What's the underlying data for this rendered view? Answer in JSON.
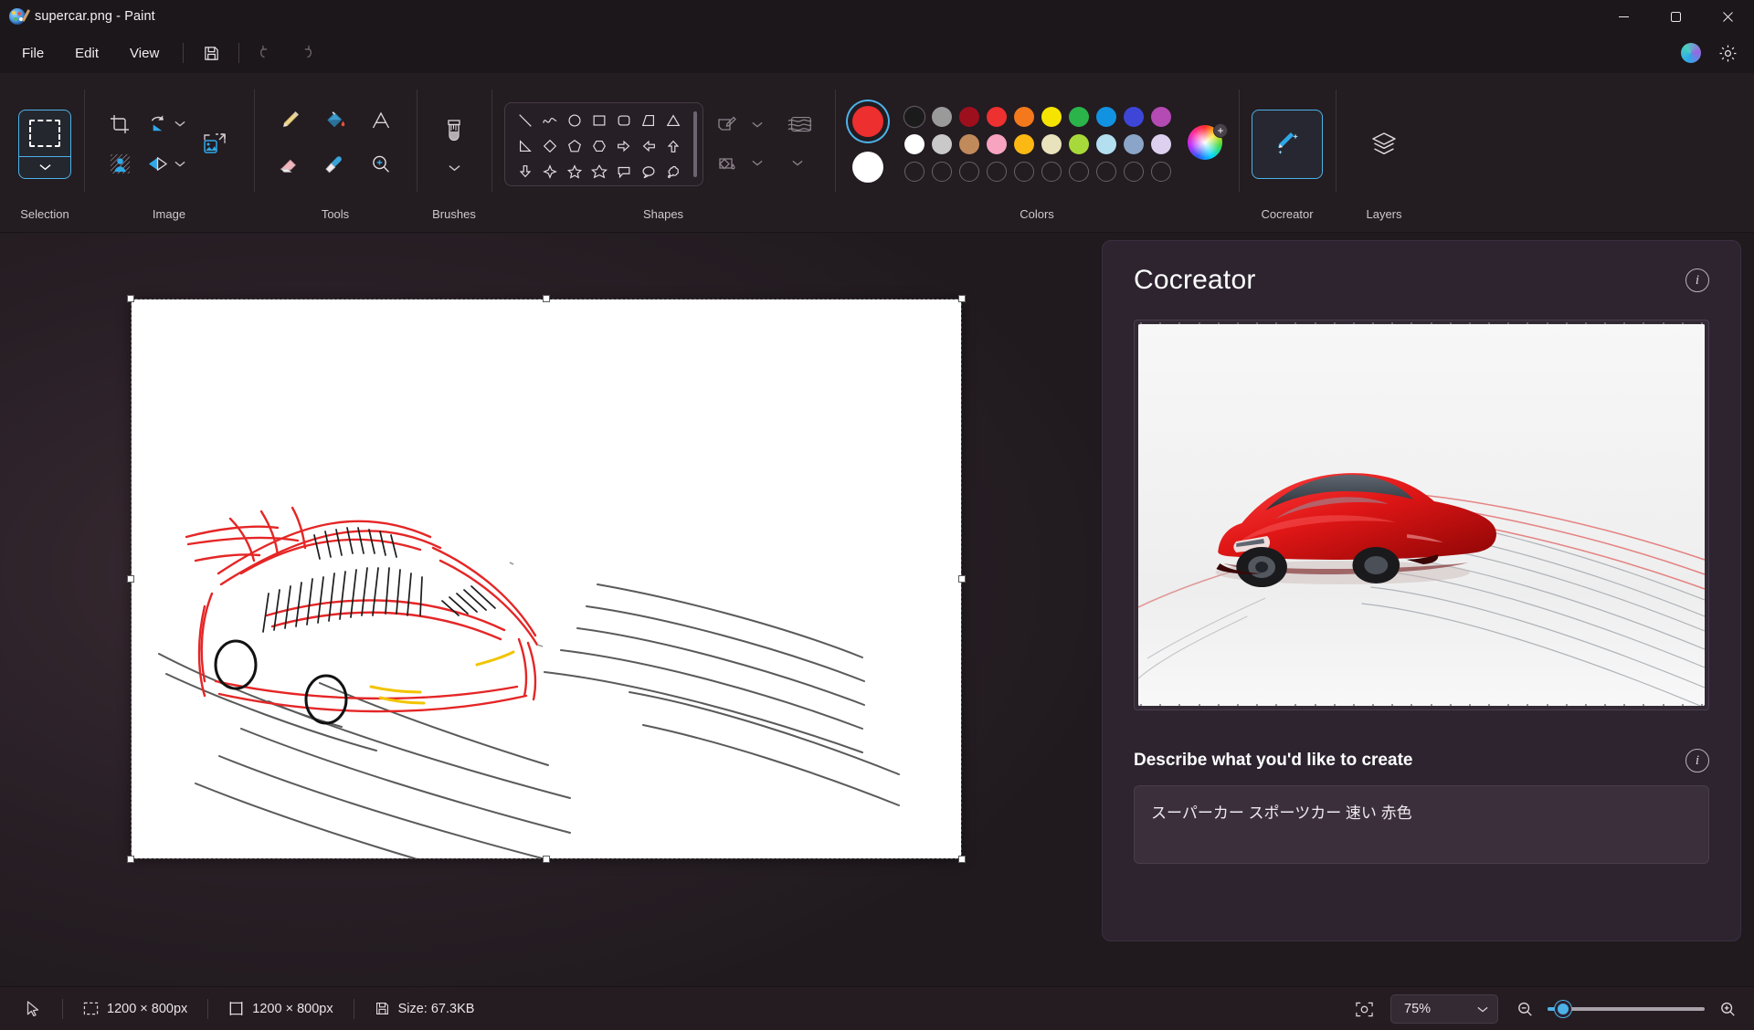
{
  "window": {
    "title": "supercar.png - Paint",
    "app_icon": "paint-palette-icon",
    "controls": {
      "minimize": "minimize-icon",
      "maximize": "maximize-icon",
      "close": "close-icon"
    }
  },
  "menubar": {
    "items": [
      {
        "label": "File",
        "name": "menu-file"
      },
      {
        "label": "Edit",
        "name": "menu-edit"
      },
      {
        "label": "View",
        "name": "menu-view"
      }
    ],
    "quick_access": [
      {
        "name": "save-icon",
        "enabled": true
      },
      {
        "name": "undo-icon",
        "enabled": false
      },
      {
        "name": "redo-icon",
        "enabled": false
      }
    ],
    "right_icons": [
      {
        "name": "copilot-icon"
      },
      {
        "name": "settings-gear-icon"
      }
    ]
  },
  "ribbon": {
    "groups": [
      {
        "label": "Selection",
        "name": "ribbon-group-selection"
      },
      {
        "label": "Image",
        "name": "ribbon-group-image"
      },
      {
        "label": "Tools",
        "name": "ribbon-group-tools"
      },
      {
        "label": "Brushes",
        "name": "ribbon-group-brushes"
      },
      {
        "label": "Shapes",
        "name": "ribbon-group-shapes"
      },
      {
        "label": "Colors",
        "name": "ribbon-group-colors"
      },
      {
        "label": "Cocreator",
        "name": "ribbon-group-cocreator"
      },
      {
        "label": "Layers",
        "name": "ribbon-group-layers"
      }
    ],
    "tools": [
      "pencil-icon",
      "fill-bucket-icon",
      "text-icon",
      "eraser-icon",
      "eyedropper-icon",
      "magnifier-icon"
    ],
    "image_tools": [
      "crop-icon",
      "rotate-icon",
      "remove-background-icon",
      "flip-icon",
      "resize-icon"
    ],
    "shapes": [
      "line",
      "curve",
      "oval",
      "rectangle",
      "rounded-rectangle",
      "right-trapezoid",
      "triangle",
      "right-triangle",
      "diamond",
      "pentagon",
      "hexagon",
      "right-arrow",
      "left-arrow",
      "up-arrow-block",
      "down-arrow",
      "four-point-star",
      "five-point-star",
      "six-point-star",
      "rounded-callout",
      "oval-callout",
      "cloud-callout"
    ],
    "shape_options": [
      "shape-outline-icon",
      "shape-fill-icon",
      "shape-style-icon"
    ]
  },
  "colors": {
    "primary": "#ed2f2f",
    "secondary": "#ffffff",
    "primary_selected": true,
    "palette_row1": [
      "#1b1b1b",
      "#9a9a9a",
      "#9e0f1e",
      "#ed3030",
      "#f3791c",
      "#f5e400",
      "#2bb44a",
      "#1193e2",
      "#3d46d6",
      "#b44ab4"
    ],
    "palette_row2": [
      "#ffffff",
      "#c9c9c9",
      "#c08a5a",
      "#f8a3bf",
      "#fdb913",
      "#e8e2bd",
      "#a8d93a",
      "#b3dff0",
      "#8aa5c8",
      "#ddd0ee"
    ],
    "palette_row3_empty_count": 10,
    "wheel": "color-wheel-icon",
    "wheel_badge": "+"
  },
  "cocreator": {
    "title": "Cocreator",
    "info_icon": "info-icon",
    "preview_alt": "red-supercar-generated-preview",
    "describe_label": "Describe what you'd like to create",
    "describe_info_icon": "info-icon",
    "prompt_value": "スーパーカー スポーツカー 速い 赤色",
    "prompt_placeholder": "Describe what you'd like to create"
  },
  "canvas": {
    "drawing_alt": "red-supercar-sketch-with-speed-lines"
  },
  "statusbar": {
    "cursor_icon": "cursor-arrow-icon",
    "selection_icon": "selection-size-icon",
    "selection_size": "1200 × 800px",
    "canvas_icon": "canvas-size-icon",
    "canvas_size": "1200 × 800px",
    "file_icon": "save-disk-icon",
    "file_size": "Size: 67.3KB",
    "fit_icon": "fit-to-window-icon",
    "zoom_level": "75%",
    "zoom_out_icon": "zoom-out-icon",
    "zoom_in_icon": "zoom-in-icon"
  }
}
